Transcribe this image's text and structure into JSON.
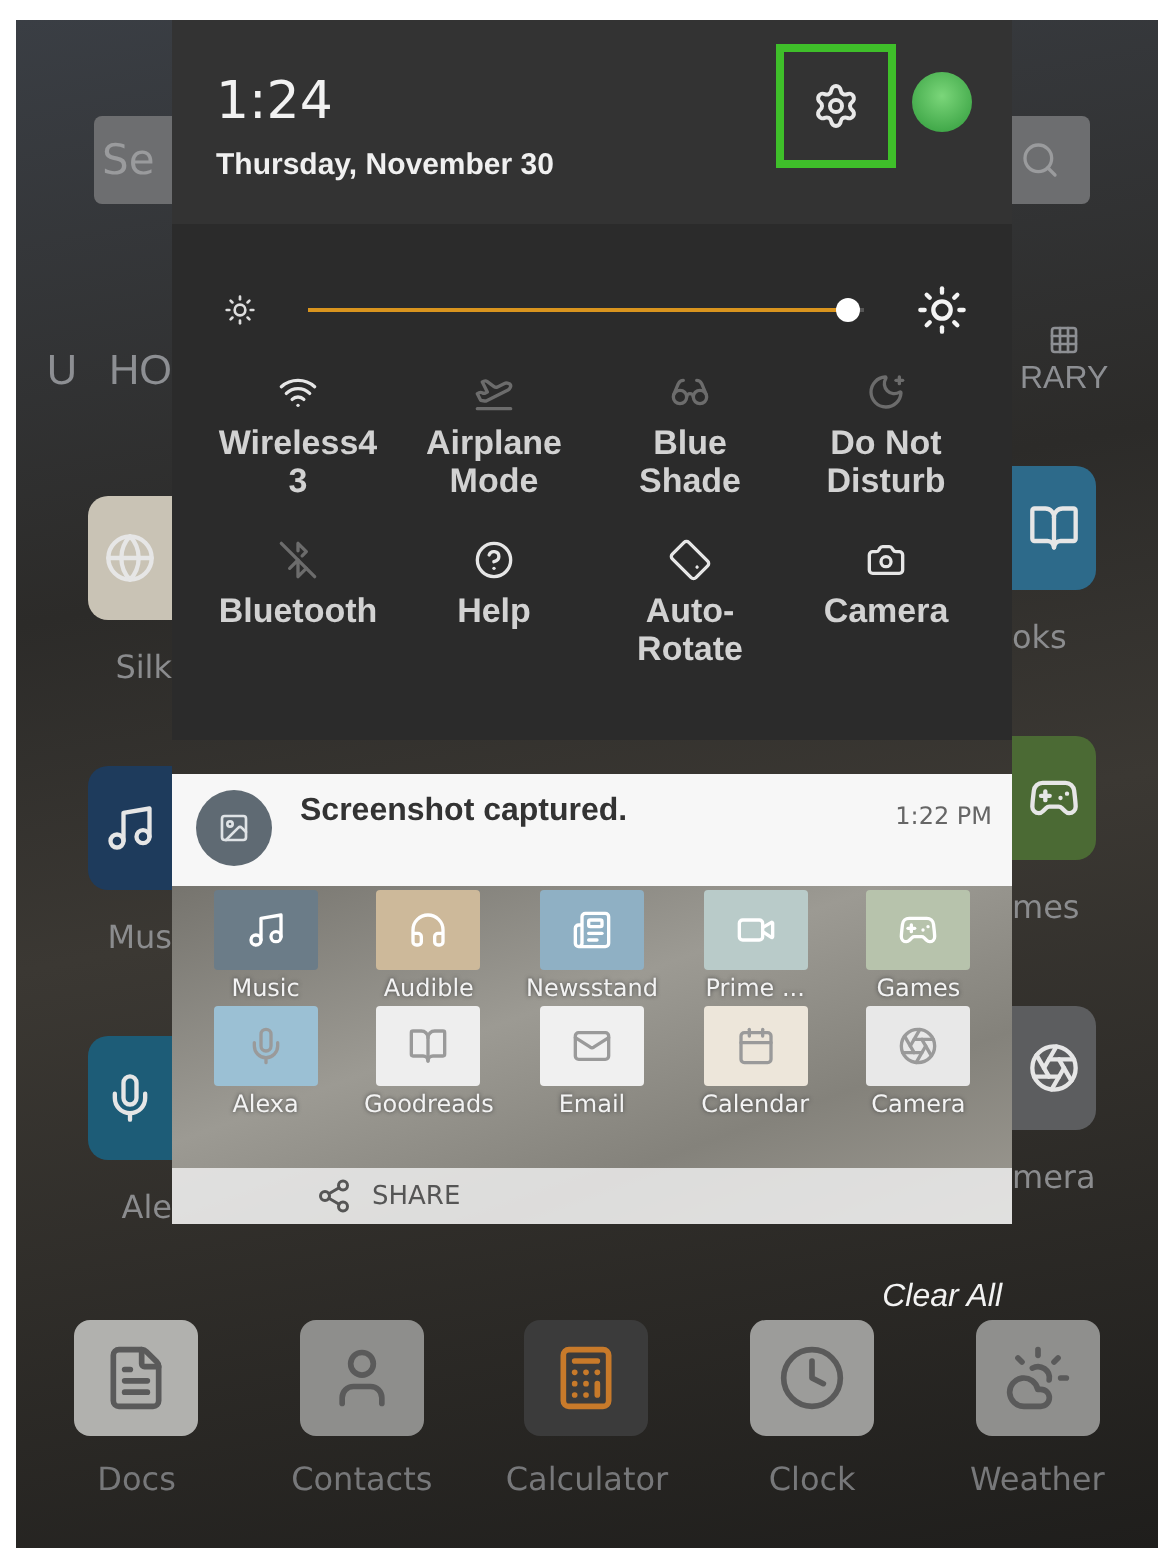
{
  "home_left": {
    "search_text": "Se",
    "tabs": [
      "U",
      "HO"
    ],
    "apps": [
      {
        "label": "Silk"
      },
      {
        "label": "Mus"
      },
      {
        "label": "Ale"
      }
    ]
  },
  "home_right": {
    "tab": "RARY",
    "apps": [
      {
        "label": "oks"
      },
      {
        "label": "mes"
      },
      {
        "label": "mera"
      }
    ]
  },
  "quick_panel": {
    "time": "1:24",
    "date": "Thursday, November 30",
    "settings_highlighted": true,
    "brightness": {
      "level": 0.97
    },
    "tiles": [
      {
        "kind": "wifi",
        "lines": [
          "Wireless4",
          "3"
        ],
        "active": true
      },
      {
        "kind": "airplane",
        "lines": [
          "Airplane",
          "Mode"
        ],
        "active": false
      },
      {
        "kind": "blueshade",
        "lines": [
          "Blue",
          "Shade"
        ],
        "active": false
      },
      {
        "kind": "dnd",
        "lines": [
          "Do Not",
          "Disturb"
        ],
        "active": false
      },
      {
        "kind": "bluetooth",
        "lines": [
          "Bluetooth"
        ],
        "active": false
      },
      {
        "kind": "help",
        "lines": [
          "Help"
        ],
        "active": true
      },
      {
        "kind": "rotate",
        "lines": [
          "Auto-",
          "Rotate"
        ],
        "active": true
      },
      {
        "kind": "camera",
        "lines": [
          "Camera"
        ],
        "active": true
      }
    ]
  },
  "notification": {
    "title": "Screenshot captured.",
    "time": "1:22 PM",
    "share": "SHARE",
    "preview_apps": [
      {
        "label": "Music"
      },
      {
        "label": "Audible"
      },
      {
        "label": "Newsstand"
      },
      {
        "label": "Prime ..."
      },
      {
        "label": "Games"
      },
      {
        "label": "Alexa"
      },
      {
        "label": "Goodreads"
      },
      {
        "label": "Email"
      },
      {
        "label": "Calendar"
      },
      {
        "label": "Camera"
      }
    ]
  },
  "clear_all": "Clear All",
  "dock_apps": [
    {
      "label": "Docs"
    },
    {
      "label": "Contacts"
    },
    {
      "label": "Calculator"
    },
    {
      "label": "Clock"
    },
    {
      "label": "Weather"
    }
  ]
}
